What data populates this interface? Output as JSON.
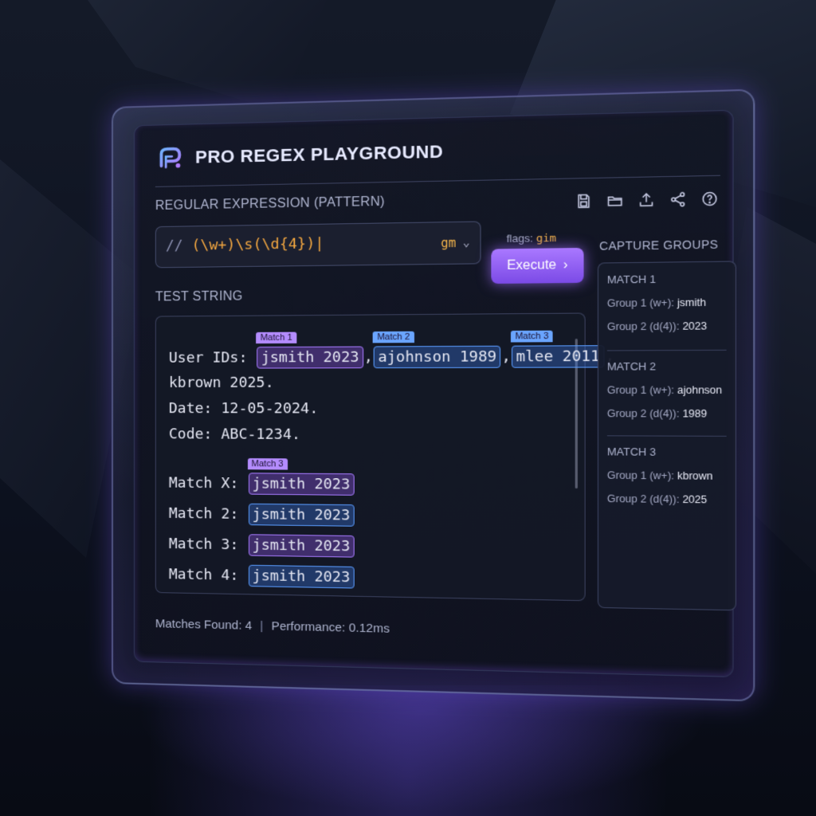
{
  "app": {
    "title": "PRO REGEX PLAYGROUND"
  },
  "toolbar": {
    "icons": [
      "save-icon",
      "open-folder-icon",
      "export-icon",
      "share-icon",
      "help-icon"
    ]
  },
  "pattern": {
    "label": "REGULAR EXPRESSION (PATTERN)",
    "delimiters": "//",
    "value": " (\\w+)\\s(\\d{4})",
    "caret": "|",
    "flags_value": "gm",
    "flags_hint_label": "flags:",
    "flags_hint_value": "gim"
  },
  "execute_button": {
    "label": "Execute",
    "icon": "chevron-right-icon"
  },
  "test_string": {
    "label": "TEST STRING",
    "line1_prefix": "User IDs: ",
    "m1_tag": "Match 1",
    "m1_text": "jsmith 2023",
    "m2_tag": "Match 2",
    "m2_text": "ajohnson 1989",
    "m3_tag": "Match 3",
    "m3_text": "mlee 2011",
    "comma": ",",
    "line2": "kbrown 2025.",
    "line3": "Date: 12-05-2024.",
    "line4": "Code: ABC-1234.",
    "matches": [
      {
        "prefix": "Match X: ",
        "tag": "Match 3",
        "text": "jsmith 2023",
        "color": "purple"
      },
      {
        "prefix": "Match 2: ",
        "tag": "",
        "text": "jsmith 2023",
        "color": "blue"
      },
      {
        "prefix": "Match 3: ",
        "tag": "",
        "text": "jsmith 2023",
        "color": "purple"
      },
      {
        "prefix": "Match 4: ",
        "tag": "",
        "text": "jsmith 2023",
        "color": "blue"
      }
    ]
  },
  "capture_groups": {
    "label": "CAPTURE GROUPS",
    "matches": [
      {
        "title": "MATCH 1",
        "g1_label": "Group 1 (w+):",
        "g1_value": "jsmith",
        "g2_label": "Group 2 (d(4)):",
        "g2_value": "2023"
      },
      {
        "title": "MATCH 2",
        "g1_label": "Group 1 (w+):",
        "g1_value": "ajohnson",
        "g2_label": "Group 2 (d(4)):",
        "g2_value": "1989"
      },
      {
        "title": "MATCH 3",
        "g1_label": "Group 1 (w+):",
        "g1_value": "kbrown",
        "g2_label": "Group 2 (d(4)):",
        "g2_value": "2025"
      }
    ]
  },
  "status": {
    "matches_found": "Matches Found: 4",
    "separator": "|",
    "performance": "Performance: 0.12ms"
  },
  "colors": {
    "accent_purple": "#a978ff",
    "accent_blue": "#5a9cff",
    "pattern_orange": "#f2a640"
  }
}
